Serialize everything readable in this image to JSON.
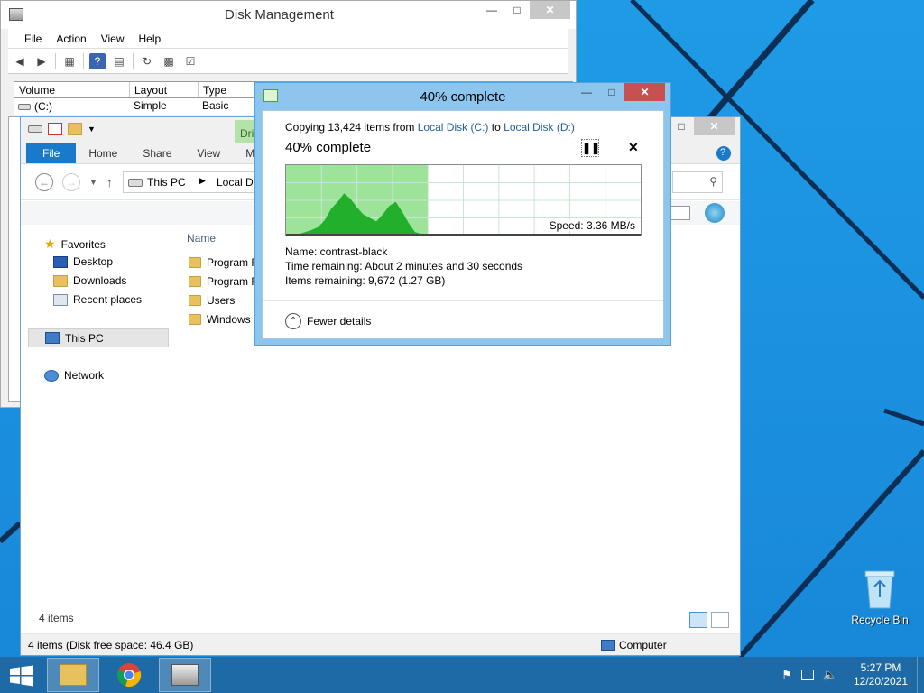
{
  "disk_management": {
    "title": "Disk Management",
    "menu": [
      "File",
      "Action",
      "View",
      "Help"
    ],
    "columns": [
      "Volume",
      "Layout",
      "Type"
    ],
    "rows": [
      {
        "volume": "(C:)",
        "layout": "Simple",
        "type": "Basic"
      }
    ]
  },
  "explorer": {
    "context_tab": "Dri",
    "ribbon_tabs": [
      "File",
      "Home",
      "Share",
      "View",
      "M"
    ],
    "address": [
      "This PC",
      "Local Di"
    ],
    "nav": {
      "favorites": "Favorites",
      "desktop": "Desktop",
      "downloads": "Downloads",
      "recent": "Recent places",
      "this_pc": "This PC",
      "network": "Network"
    },
    "column_name": "Name",
    "folders": [
      "Program F",
      "Program F",
      "Users",
      "Windows"
    ],
    "item_count": "4 items",
    "status_left": "4 items (Disk free space: 46.4 GB)",
    "status_right": "Computer"
  },
  "copy_dialog": {
    "title": "40% complete",
    "copying_prefix": "Copying 13,424 items from",
    "source": "Local Disk (C:)",
    "to_word": "to",
    "destination": "Local Disk (D:)",
    "heading": "40% complete",
    "progress_fraction": 0.4,
    "speed": "Speed: 3.36 MB/s",
    "name_line": "Name:  contrast-black",
    "time_line": "Time remaining:  About 2 minutes and 30 seconds",
    "items_line": "Items remaining:  9,672 (1.27 GB)",
    "fewer_details": "Fewer details",
    "throughput_profile": [
      0,
      0,
      0.02,
      0.05,
      0.08,
      0.12,
      0.22,
      0.38,
      0.48,
      0.6,
      0.52,
      0.4,
      0.3,
      0.25,
      0.2,
      0.3,
      0.42,
      0.48,
      0.34,
      0.18,
      0.05,
      0.02,
      0.0
    ]
  },
  "desktop": {
    "recycle_bin": "Recycle Bin"
  },
  "taskbar": {
    "time": "5:27 PM",
    "date": "12/20/2021"
  },
  "colors": {
    "desktop_bg": "#1f9be6",
    "taskbar": "#1d6aa6",
    "graph_fill": "#22b02c",
    "graph_bg_done": "#9ee39a",
    "accent": "#1979ca"
  }
}
